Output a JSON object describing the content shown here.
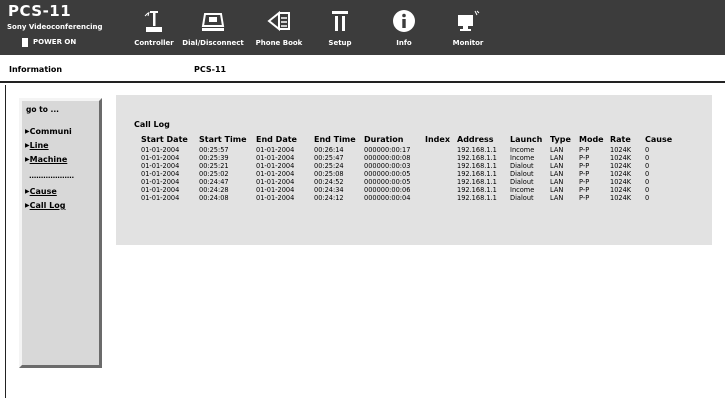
{
  "brand": {
    "title": "PCS-11",
    "subtitle": "Sony Videoconferencing",
    "power": "POWER ON"
  },
  "nav": [
    {
      "label": "Controller",
      "icon": "controller-icon"
    },
    {
      "label": "Dial/Disconnect",
      "icon": "dial-icon"
    },
    {
      "label": "Phone Book",
      "icon": "phone-book-icon"
    },
    {
      "label": "Setup",
      "icon": "setup-icon"
    },
    {
      "label": "Info",
      "icon": "info-icon"
    },
    {
      "label": "Monitor",
      "icon": "monitor-icon"
    }
  ],
  "infobar": {
    "label": "Information",
    "model": "PCS-11"
  },
  "sidebar": {
    "goto": "go to ...",
    "items": [
      {
        "label": "Communi",
        "link": false
      },
      {
        "label": "Line",
        "link": true
      },
      {
        "label": "Machine",
        "link": true
      },
      {
        "label": "Cause",
        "link": true
      },
      {
        "label": "Call Log",
        "link": true
      }
    ],
    "separator": "..................."
  },
  "call_log": {
    "title": "Call Log",
    "columns": [
      "Start Date",
      "Start Time",
      "End Date",
      "End Time",
      "Duration",
      "Index",
      "Address",
      "Launch",
      "Type",
      "Mode",
      "Rate",
      "Cause"
    ],
    "rows": [
      [
        "01-01-2004",
        "00:25:57",
        "01-01-2004",
        "00:26:14",
        "000000:00:17",
        "",
        "192.168.1.1",
        "Income",
        "LAN",
        "P-P",
        "1024K",
        "0"
      ],
      [
        "01-01-2004",
        "00:25:39",
        "01-01-2004",
        "00:25:47",
        "000000:00:08",
        "",
        "192.168.1.1",
        "Income",
        "LAN",
        "P-P",
        "1024K",
        "0"
      ],
      [
        "01-01-2004",
        "00:25:21",
        "01-01-2004",
        "00:25:24",
        "000000:00:03",
        "",
        "192.168.1.1",
        "Dialout",
        "LAN",
        "P-P",
        "1024K",
        "0"
      ],
      [
        "01-01-2004",
        "00:25:02",
        "01-01-2004",
        "00:25:08",
        "000000:00:05",
        "",
        "192.168.1.1",
        "Dialout",
        "LAN",
        "P-P",
        "1024K",
        "0"
      ],
      [
        "01-01-2004",
        "00:24:47",
        "01-01-2004",
        "00:24:52",
        "000000:00:05",
        "",
        "192.168.1.1",
        "Dialout",
        "LAN",
        "P-P",
        "1024K",
        "0"
      ],
      [
        "01-01-2004",
        "00:24:28",
        "01-01-2004",
        "00:24:34",
        "000000:00:06",
        "",
        "192.168.1.1",
        "Income",
        "LAN",
        "P-P",
        "1024K",
        "0"
      ],
      [
        "01-01-2004",
        "00:24:08",
        "01-01-2004",
        "00:24:12",
        "000000:00:04",
        "",
        "192.168.1.1",
        "Dialout",
        "LAN",
        "P-P",
        "1024K",
        "0"
      ]
    ]
  }
}
